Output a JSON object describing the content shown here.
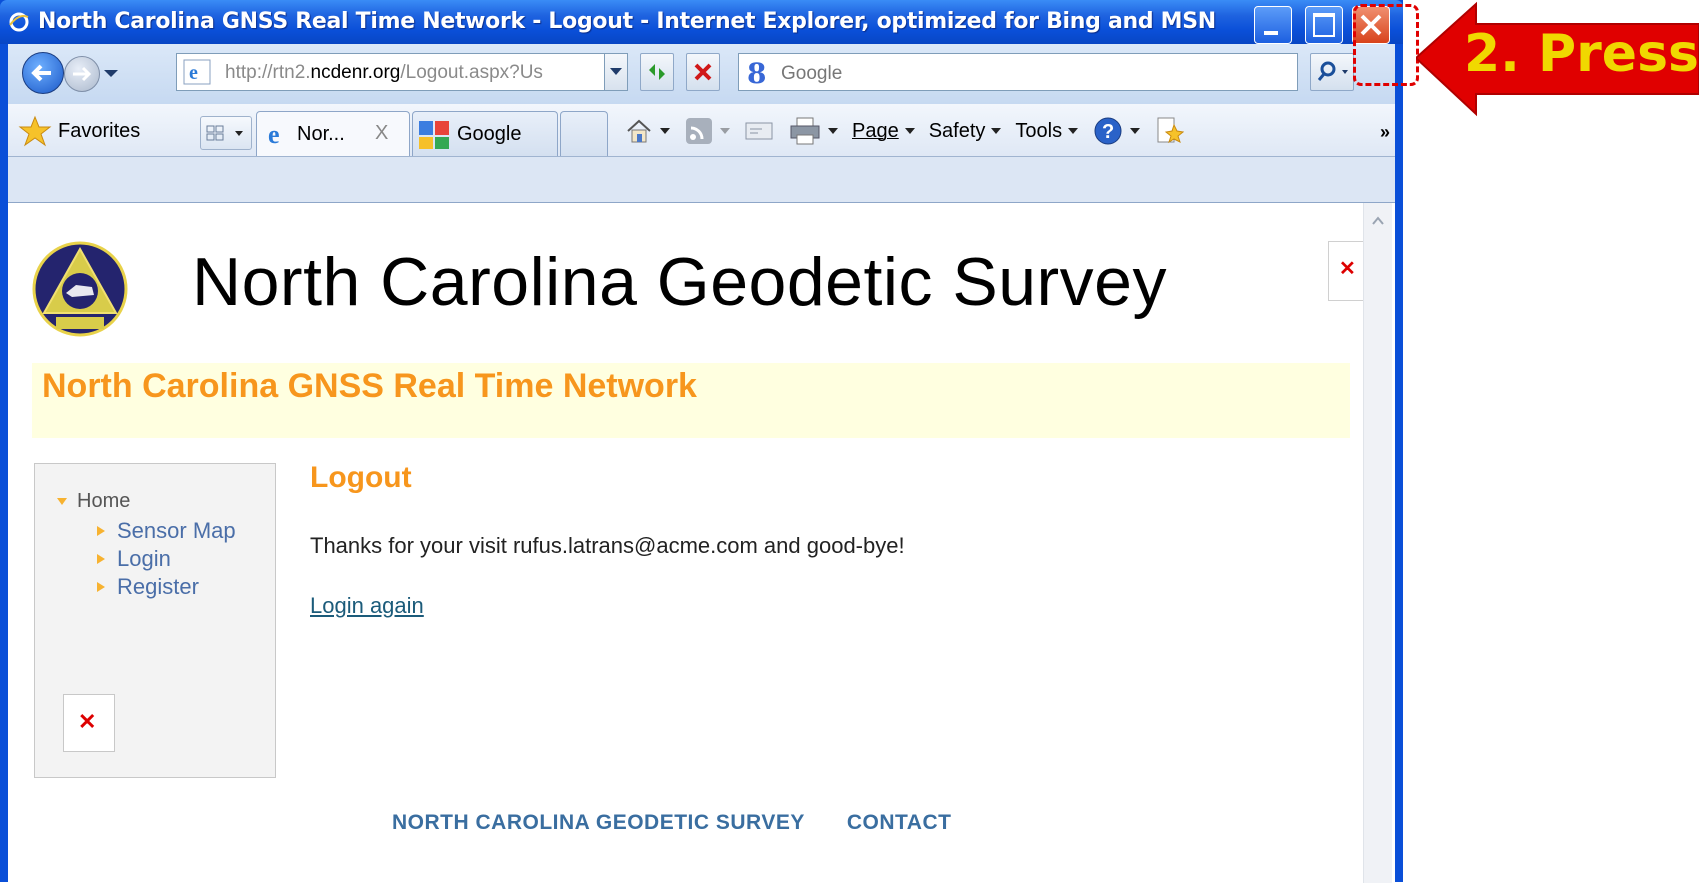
{
  "window": {
    "title": "North Carolina GNSS Real Time Network - Logout - Internet Explorer, optimized for Bing and MSN"
  },
  "toolbar": {
    "address_domain_prefix": "http://rtn2.",
    "address_domain": "ncdenr.org",
    "address_path": "/Logout.aspx?Us",
    "search_placeholder": "Google"
  },
  "favorites_bar": {
    "favorites_label": "Favorites",
    "tabs": [
      {
        "label": "Nor...",
        "close": "X"
      },
      {
        "label": "Google"
      }
    ],
    "commands": [
      "Page",
      "Safety",
      "Tools"
    ],
    "overflow": "»"
  },
  "page": {
    "site_title": "North Carolina Geodetic Survey",
    "subtitle": "North Carolina GNSS Real Time Network",
    "nav": {
      "home": "Home",
      "items": [
        "Sensor Map",
        "Login",
        "Register"
      ]
    },
    "heading": "Logout",
    "message": "Thanks for your visit rufus.latrans@acme.com and good-bye!",
    "link": "Login again",
    "footer_links": [
      "NORTH CAROLINA GEODETIC SURVEY",
      "CONTACT"
    ]
  },
  "annotation": {
    "callout_text": "2. Press",
    "color": "#e00000",
    "text_color": "#f0d800"
  },
  "colors": {
    "accent_orange": "#f7961d",
    "titlebar_blue": "#0a4fd8",
    "band_yellow": "#ffffe0"
  }
}
